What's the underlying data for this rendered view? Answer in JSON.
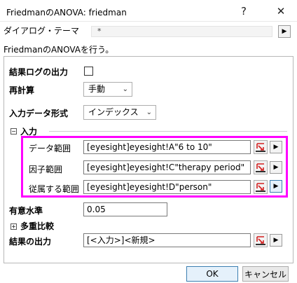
{
  "window": {
    "title": "FriedmanのANOVA: friedman",
    "help_glyph": "?",
    "close_glyph": "✕"
  },
  "theme": {
    "label": "ダイアログ・テーマ",
    "value": "*",
    "arrow_glyph": "▶"
  },
  "description": "FriedmanのANOVAを行う。",
  "options": {
    "result_log_label": "結果ログの出力",
    "result_log_checked": false,
    "recalc_label": "再計算",
    "recalc_value": "手動",
    "input_format_label": "入力データ形式",
    "input_format_value": "インデックス"
  },
  "input_group": {
    "toggle_glyph": "−",
    "label": "入力",
    "rows": [
      {
        "label": "データ範囲",
        "value": "[eyesight]eyesight!A\"6 to 10\""
      },
      {
        "label": "因子範囲",
        "value": "[eyesight]eyesight!C\"therapy period\""
      },
      {
        "label": "従属する範囲",
        "value": "[eyesight]eyesight!D\"person\""
      }
    ]
  },
  "significance": {
    "label": "有意水準",
    "value": "0.05"
  },
  "multiple_comparison": {
    "toggle_glyph": "+",
    "label": "多重比較"
  },
  "output": {
    "label": "結果の出力",
    "value": "[<入力>]<新規>"
  },
  "buttons": {
    "ok": "OK",
    "cancel": "キャンセル"
  },
  "colors": {
    "highlight": "#ff00ff",
    "picker_red": "#d32020"
  }
}
